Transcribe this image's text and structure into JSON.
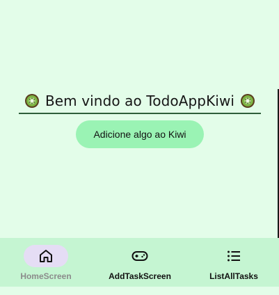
{
  "welcome": {
    "title": "Bem vindo ao TodoAppKiwi"
  },
  "actions": {
    "add_label": "Adicione algo ao Kiwi"
  },
  "nav": {
    "items": [
      {
        "label": "HomeScreen",
        "icon": "home-icon",
        "active": true
      },
      {
        "label": "AddTaskScreen",
        "icon": "gamepad-icon",
        "active": false
      },
      {
        "label": "ListAllTasks",
        "icon": "list-icon",
        "active": false
      }
    ]
  },
  "colors": {
    "background": "#e3fde9",
    "nav_background": "#c5f5d2",
    "button": "#9af3b4",
    "active_indicator": "#e5ddf5",
    "divider": "#2e5e3a",
    "inactive_label": "#8b8b8b"
  }
}
